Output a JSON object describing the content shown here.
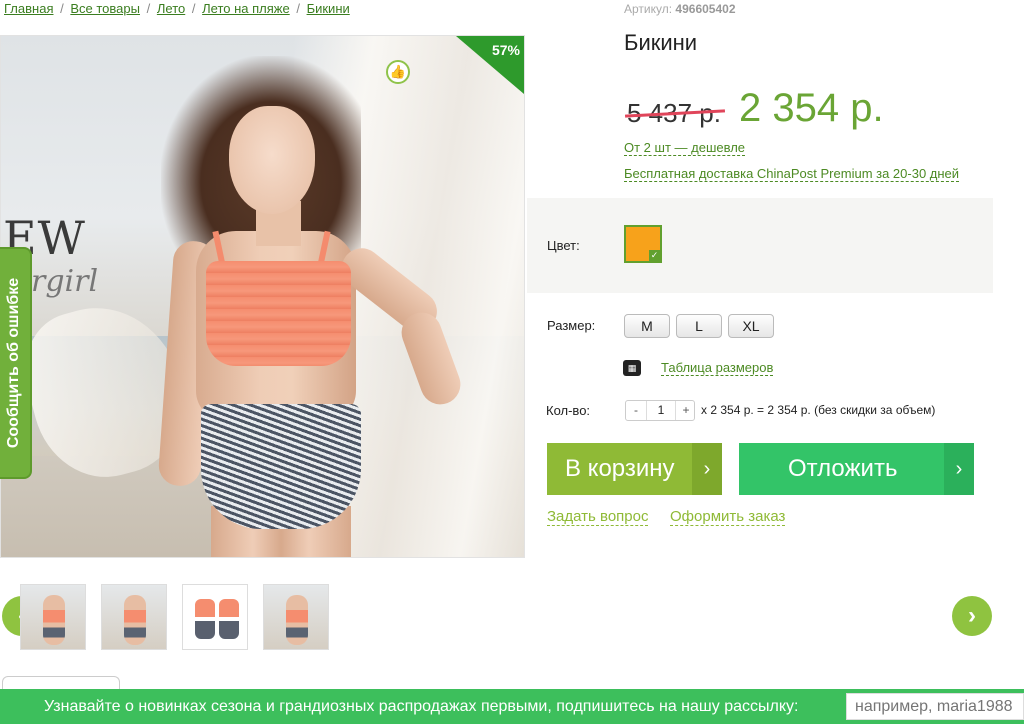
{
  "breadcrumb": {
    "items": [
      "Главная",
      "Все товары",
      "Лето",
      "Лето на пляже",
      "Бикини"
    ],
    "separator": "/"
  },
  "product": {
    "article_label": "Артикул:",
    "article_number": "496605402",
    "title": "Бикини",
    "old_price": "5 437 р.",
    "new_price": "2 354 р.",
    "discount_badge": "57%",
    "promo_bulk": "От 2 шт — дешевле",
    "promo_delivery": "Бесплатная доставка ChinaPost Premium за 20-30 дней",
    "image_overlay_text": {
      "ew": "EW",
      "girl": "rgirl"
    }
  },
  "options": {
    "color_label": "Цвет:",
    "color_value": "#f7a21b",
    "size_label": "Размер:",
    "sizes": [
      "M",
      "L",
      "XL"
    ],
    "size_table_link": "Таблица размеров",
    "qty_label": "Кол-во:",
    "qty_minus": "-",
    "qty_value": "1",
    "qty_plus": "+",
    "qty_calc": "x 2 354 р.  = 2 354 р.  (без скидки за объем)"
  },
  "actions": {
    "cart_label": "В корзину",
    "later_label": "Отложить",
    "ask_question": "Задать вопрос",
    "place_order": "Оформить заказ",
    "arrow": "›"
  },
  "report_tab": "Сообщить об ошибке",
  "thumbnails_nav": {
    "prev": "‹",
    "next": "›"
  },
  "newsletter": {
    "text": "Узнавайте о новинках сезона и грандиозных распродажах первыми, подпишитесь на нашу рассылку:",
    "placeholder": "например, maria1988"
  },
  "colors": {
    "accent_green": "#8fba36",
    "save_green": "#33c468",
    "newsletter_green": "#3dbf5c",
    "price_green": "#6aa535",
    "strike_red": "#e0455a"
  }
}
